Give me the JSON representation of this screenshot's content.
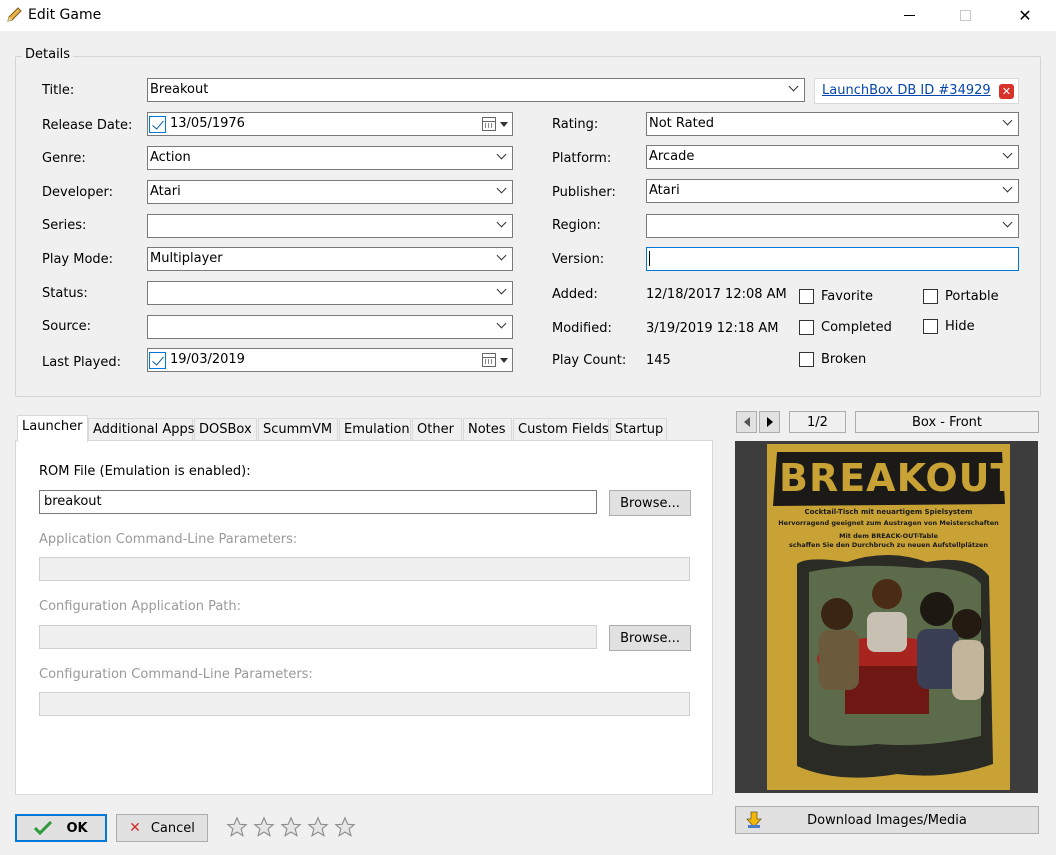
{
  "window": {
    "title": "Edit Game",
    "minimize": "—",
    "maximize": "☐",
    "close": "✕"
  },
  "details": {
    "legend": "Details",
    "title_label": "Title:",
    "title_value": "Breakout",
    "db_link": "LaunchBox DB ID #34929",
    "release_label": "Release Date:",
    "release_value": "13/05/1976",
    "genre_label": "Genre:",
    "genre_value": "Action",
    "developer_label": "Developer:",
    "developer_value": "Atari",
    "series_label": "Series:",
    "series_value": "",
    "playmode_label": "Play Mode:",
    "playmode_value": "Multiplayer",
    "status_label": "Status:",
    "status_value": "",
    "source_label": "Source:",
    "source_value": "",
    "lastplayed_label": "Last Played:",
    "lastplayed_value": "19/03/2019",
    "rating_label": "Rating:",
    "rating_value": "Not Rated",
    "platform_label": "Platform:",
    "platform_value": "Arcade",
    "publisher_label": "Publisher:",
    "publisher_value": "Atari",
    "region_label": "Region:",
    "region_value": "",
    "version_label": "Version:",
    "version_value": "",
    "added_label": "Added:",
    "added_value": "12/18/2017 12:08 AM",
    "modified_label": "Modified:",
    "modified_value": "3/19/2019 12:18 AM",
    "playcount_label": "Play Count:",
    "playcount_value": "145",
    "checkboxes": {
      "favorite": "Favorite",
      "portable": "Portable",
      "completed": "Completed",
      "hide": "Hide",
      "broken": "Broken"
    }
  },
  "tabs": [
    "Launcher",
    "Additional Apps",
    "DOSBox",
    "ScummVM",
    "Emulation",
    "Other",
    "Notes",
    "Custom Fields",
    "Startup"
  ],
  "launcher": {
    "rom_label": "ROM File (Emulation is enabled):",
    "rom_value": "breakout",
    "browse": "Browse...",
    "cmdline_label": "Application Command-Line Parameters:",
    "config_path_label": "Configuration Application Path:",
    "config_cmdline_label": "Configuration Command-Line Parameters:"
  },
  "images": {
    "counter": "1/2",
    "type": "Box - Front",
    "download": "Download Images/Media",
    "poster": {
      "logo": "BREAKOUT",
      "line1": "Cocktail-Tisch mit neuartigem Spielsystem",
      "line2": "Hervorragend geeignet zum Austragen von Meisterschaften",
      "line3": "Mit dem BREACK-OUT-Table",
      "line4": "schaffen Sie den Durchbruch zu neuen Aufstellplätzen"
    }
  },
  "footer": {
    "ok": "OK",
    "cancel": "Cancel",
    "rating_stars": 0,
    "stars_total": 5
  },
  "colors": {
    "accent": "#0078d7",
    "link": "#0645ad",
    "poster_bg": "#c9a236"
  }
}
